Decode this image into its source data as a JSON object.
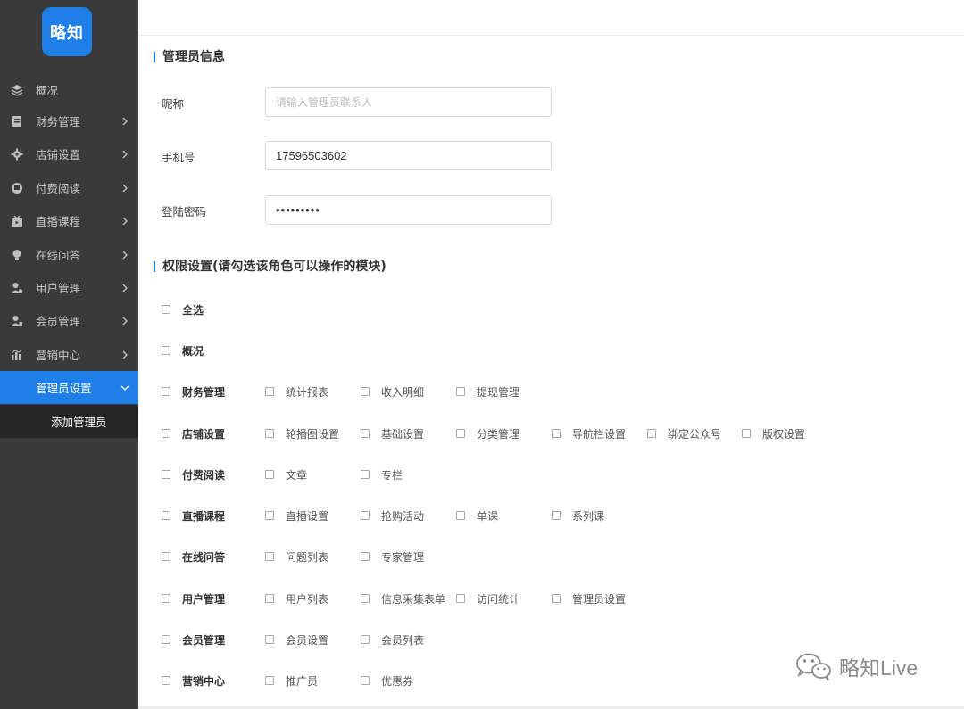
{
  "app": {
    "logo_text": "略知"
  },
  "sidebar": {
    "items": [
      {
        "label": "概况",
        "icon": "layers-icon",
        "chevron": false
      },
      {
        "label": "财务管理",
        "icon": "ledger-icon",
        "chevron": true
      },
      {
        "label": "店铺设置",
        "icon": "gear-icon",
        "chevron": true
      },
      {
        "label": "付费阅读",
        "icon": "reading-icon",
        "chevron": true
      },
      {
        "label": "直播课程",
        "icon": "tv-icon",
        "chevron": true
      },
      {
        "label": "在线问答",
        "icon": "lightbulb-icon",
        "chevron": true
      },
      {
        "label": "用户管理",
        "icon": "user-gear-icon",
        "chevron": true
      },
      {
        "label": "会员管理",
        "icon": "member-icon",
        "chevron": true
      },
      {
        "label": "营销中心",
        "icon": "bar-chart-icon",
        "chevron": true
      },
      {
        "label": "管理员设置",
        "icon": "",
        "chevron": true,
        "active": true
      }
    ],
    "sub_item": {
      "label": "添加管理员"
    }
  },
  "admin_info": {
    "title": "管理员信息",
    "nickname": {
      "label": "昵称",
      "value": "",
      "placeholder": "请输入管理员联系人"
    },
    "phone": {
      "label": "手机号",
      "value": "17596503602"
    },
    "password": {
      "label": "登陆密码",
      "value": "•••••••••"
    }
  },
  "permissions": {
    "title": "权限设置(请勾选该角色可以操作的模块)",
    "select_all": "全选",
    "rows": [
      {
        "label": "概况",
        "subs": []
      },
      {
        "label": "财务管理",
        "subs": [
          "统计报表",
          "收入明细",
          "提现管理"
        ]
      },
      {
        "label": "店铺设置",
        "subs": [
          "轮播图设置",
          "基础设置",
          "分类管理",
          "导航栏设置",
          "绑定公众号",
          "版权设置"
        ]
      },
      {
        "label": "付费阅读",
        "subs": [
          "文章",
          "专栏"
        ]
      },
      {
        "label": "直播课程",
        "subs": [
          "直播设置",
          "抢购活动",
          "单课",
          "系列课"
        ]
      },
      {
        "label": "在线问答",
        "subs": [
          "问题列表",
          "专家管理"
        ]
      },
      {
        "label": "用户管理",
        "subs": [
          "用户列表",
          "信息采集表单",
          "访问统计",
          "管理员设置"
        ]
      },
      {
        "label": "会员管理",
        "subs": [
          "会员设置",
          "会员列表"
        ]
      },
      {
        "label": "营销中心",
        "subs": [
          "推广员",
          "优惠券"
        ]
      }
    ]
  },
  "watermark": {
    "text": "略知Live"
  },
  "colors": {
    "accent": "#1f7fe8",
    "sidebar_bg": "#3a3a3a",
    "sub_bg": "#262626"
  }
}
